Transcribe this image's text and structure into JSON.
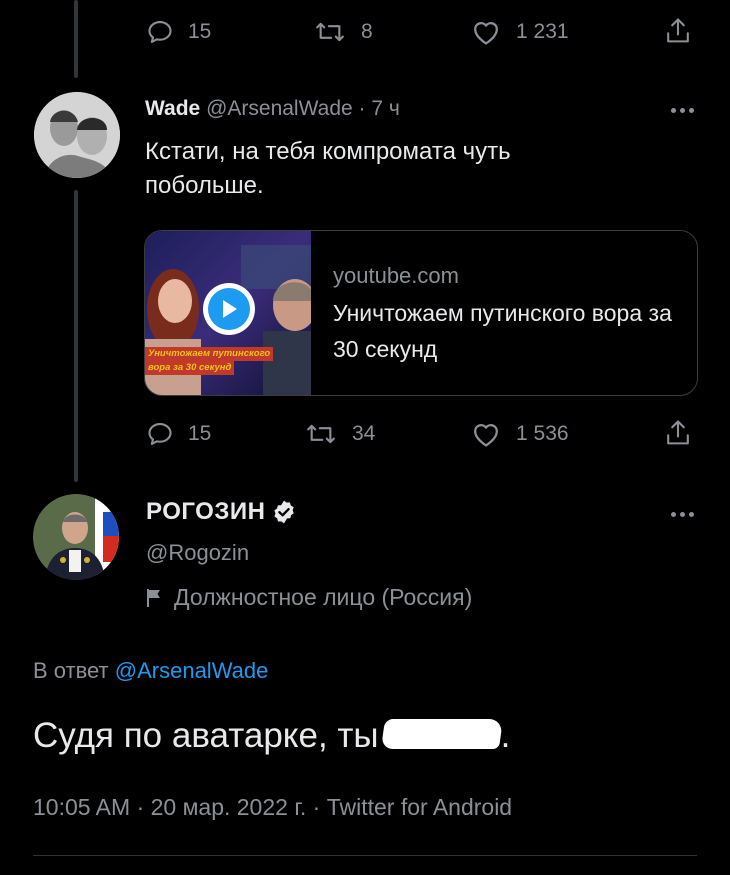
{
  "colors": {
    "background": "#000000",
    "text": "#e7e9ea",
    "muted": "#8b9096",
    "link": "#1d9bf0",
    "divider": "#2f3336"
  },
  "top_actions": {
    "replies": "15",
    "retweets": "8",
    "likes": "1 231"
  },
  "reply_tweet": {
    "name": "Wade",
    "handle": "@ArsenalWade",
    "time": "· 7 ч",
    "text": "Кстати, на тебя компромата чуть побольше.",
    "card": {
      "domain": "youtube.com",
      "title": "Уничтожаем путинского вора за 30 секунд",
      "thumb_caption_line1": "Уничтожаем путинского",
      "thumb_caption_line2": "вора за 30 секунд"
    },
    "actions": {
      "replies": "15",
      "retweets": "34",
      "likes": "1 536"
    }
  },
  "main_tweet": {
    "name": "РОГОЗИН",
    "handle": "@Rogozin",
    "label": "Должностное лицо (Россия)",
    "reply_prefix": "В ответ",
    "reply_to": "@ArsenalWade",
    "text": "Судя по аватарке, ты",
    "text_end": ".",
    "meta": "10:05 AM · 20 мар. 2022 г. · Twitter for Android"
  },
  "icons": [
    "reply-icon",
    "retweet-icon",
    "like-icon",
    "share-icon",
    "more-icon",
    "verified-badge-icon",
    "play-icon",
    "flag-icon"
  ]
}
